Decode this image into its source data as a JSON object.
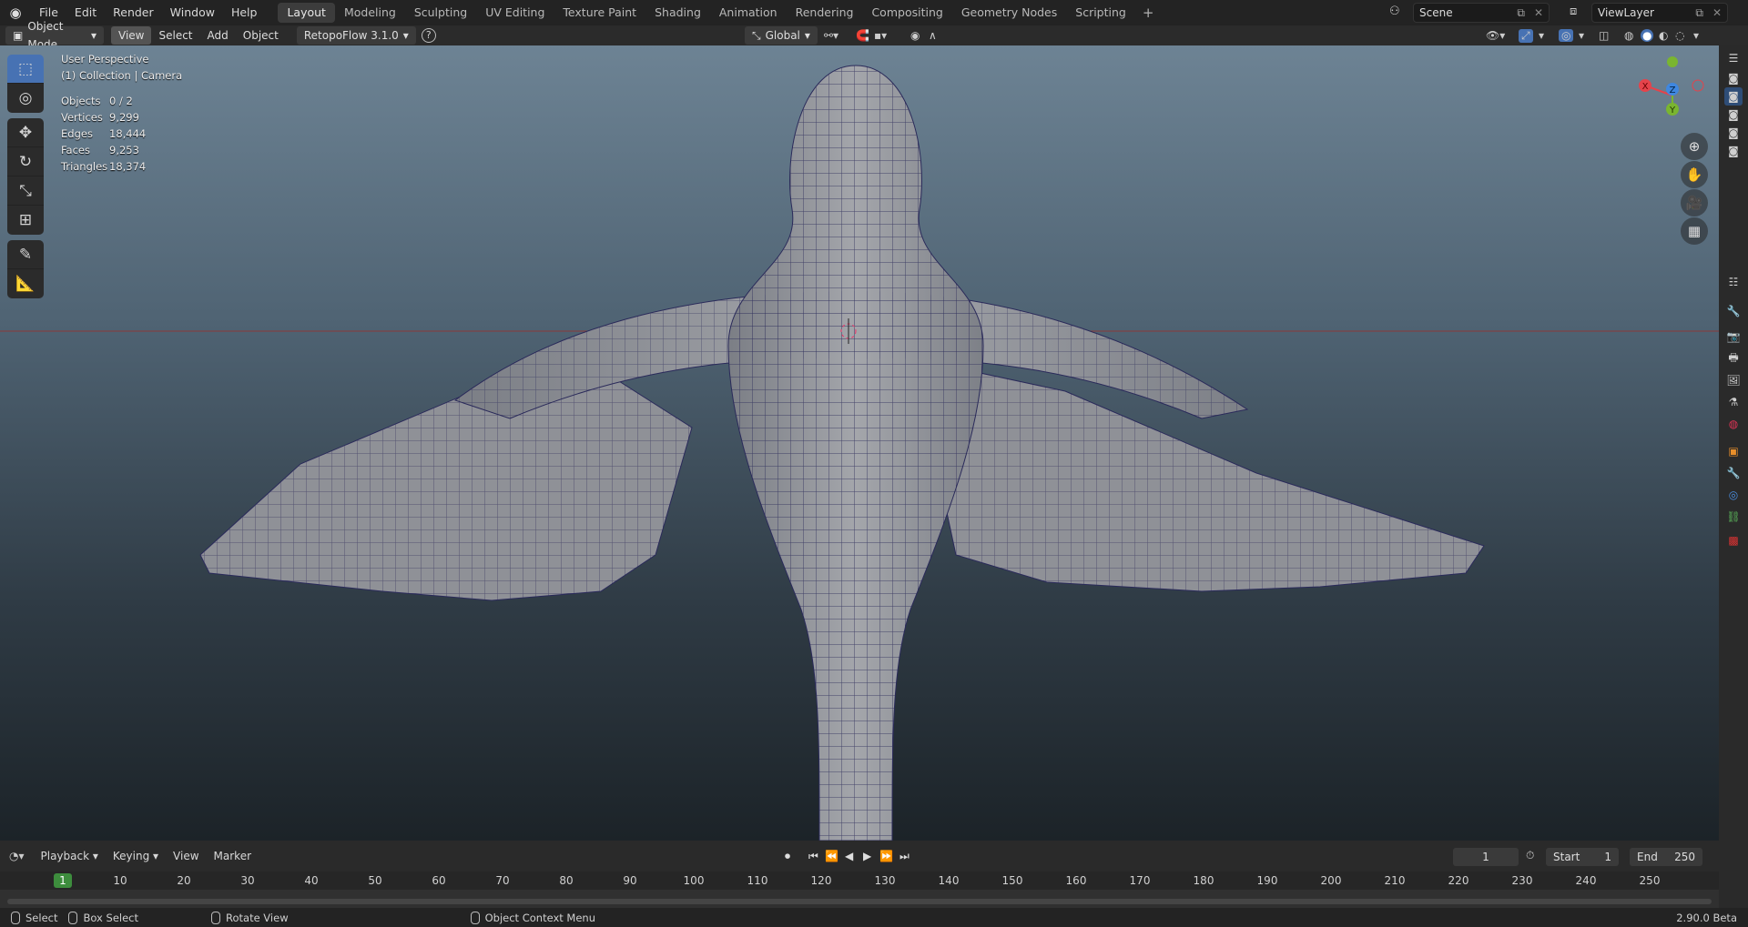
{
  "menus": [
    "File",
    "Edit",
    "Render",
    "Window",
    "Help"
  ],
  "workspaces": [
    "Layout",
    "Modeling",
    "Sculpting",
    "UV Editing",
    "Texture Paint",
    "Shading",
    "Animation",
    "Rendering",
    "Compositing",
    "Geometry Nodes",
    "Scripting"
  ],
  "active_workspace": "Layout",
  "scene": "Scene",
  "view_layer": "ViewLayer",
  "header": {
    "mode": "Object Mode",
    "view": "View",
    "select": "Select",
    "add": "Add",
    "object": "Object",
    "addon": "RetopoFlow 3.1.0",
    "orientation": "Global"
  },
  "viewport": {
    "perspective": "User Perspective",
    "collection": "(1) Collection | Camera",
    "stats": [
      {
        "label": "Objects",
        "value": "0 / 2"
      },
      {
        "label": "Vertices",
        "value": "9,299"
      },
      {
        "label": "Edges",
        "value": "18,444"
      },
      {
        "label": "Faces",
        "value": "9,253"
      },
      {
        "label": "Triangles",
        "value": "18,374"
      }
    ]
  },
  "gizmo": {
    "x_label": "X",
    "y_label": "Y",
    "z_label": "Z",
    "x_color": "#e5434b",
    "y_color": "#7ab530",
    "z_color": "#3f87e0"
  },
  "timeline": {
    "playback": "Playback",
    "keying": "Keying",
    "view": "View",
    "marker": "Marker",
    "current_frame": "1",
    "start_label": "Start",
    "start": "1",
    "end_label": "End",
    "end": "250",
    "marker_current": "1",
    "ticks": [
      "10",
      "20",
      "30",
      "40",
      "50",
      "60",
      "70",
      "80",
      "90",
      "100",
      "110",
      "120",
      "130",
      "140",
      "150",
      "160",
      "170",
      "180",
      "190",
      "200",
      "210",
      "220",
      "230",
      "240",
      "250"
    ]
  },
  "status": {
    "select": "Select",
    "box_select": "Box Select",
    "rotate": "Rotate View",
    "context": "Object Context Menu",
    "version": "2.90.0 Beta"
  }
}
